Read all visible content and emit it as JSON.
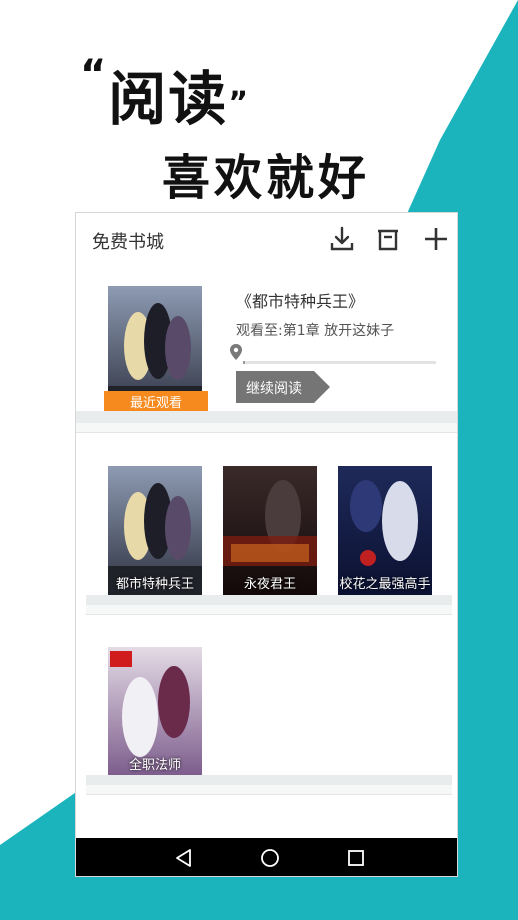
{
  "promo": {
    "quote_open": "“",
    "headline": "阅读",
    "quote_close": "”",
    "subline": "喜欢就好"
  },
  "colors": {
    "teal": "#1bb4bd",
    "accent_orange": "#f78a1e",
    "continue_gray": "#757575"
  },
  "app": {
    "title": "免费书城",
    "actions": [
      "download-icon",
      "archive-icon",
      "add-icon"
    ]
  },
  "current_reading": {
    "title": "《都市特种兵王》",
    "progress_text": "观看至:第1章 放开这妹子",
    "continue_label": "继续阅读",
    "recent_tag": "最近观看",
    "cover_title": "都市特种兵王"
  },
  "shelf": [
    {
      "title": "都市特种兵王"
    },
    {
      "title": "永夜君王"
    },
    {
      "title": "校花之最强高手"
    },
    {
      "title": "全职法师"
    }
  ],
  "navbar": [
    "back-icon",
    "home-icon",
    "recents-icon"
  ]
}
